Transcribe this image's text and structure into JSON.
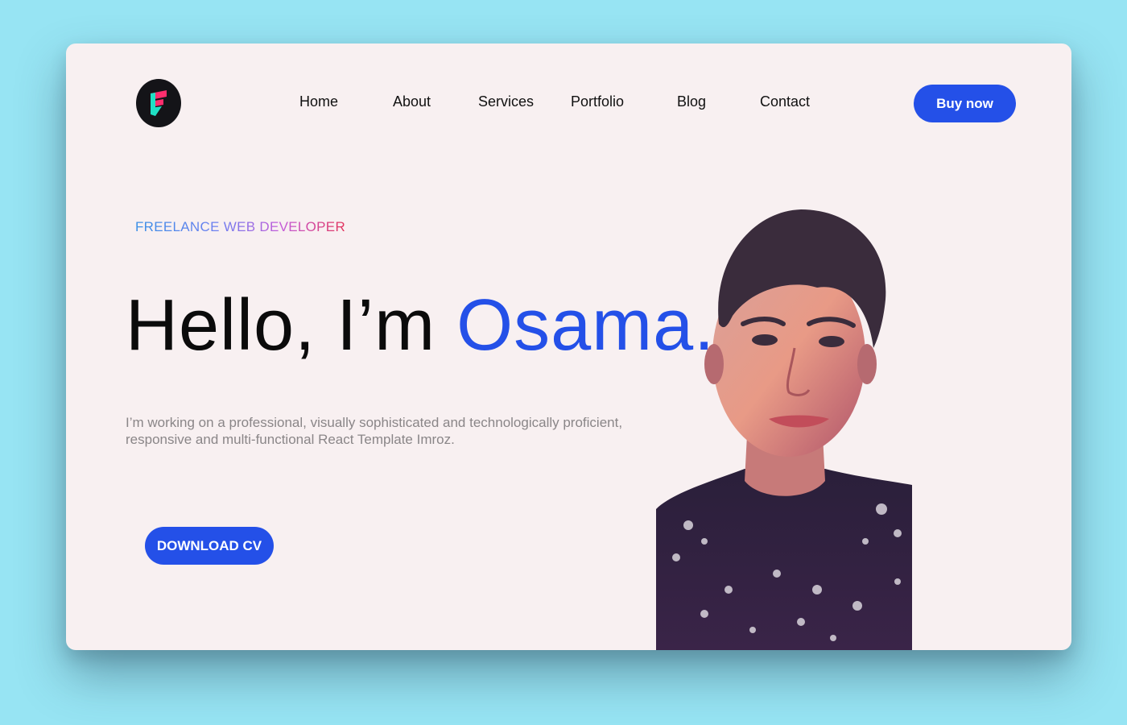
{
  "nav": {
    "items": [
      {
        "label": "Home"
      },
      {
        "label": "About"
      },
      {
        "label": "Services"
      },
      {
        "label": "Portfolio"
      },
      {
        "label": "Blog"
      },
      {
        "label": "Contact"
      }
    ],
    "cta_label": "Buy now"
  },
  "hero": {
    "tagline": "FREELANCE WEB DEVELOPER",
    "title_prefix": "Hello, I’m ",
    "title_name": "Osama.",
    "description": "I’m working on a professional, visually sophisticated and technologically proficient, responsive and multi-functional React Template Imroz.",
    "cv_button_label": "DOWNLOAD CV"
  },
  "colors": {
    "accent": "#2450e8",
    "background": "#97e4f3",
    "card": "#f8f0f1"
  },
  "icons": {
    "logo": "brand-logo-icon"
  }
}
